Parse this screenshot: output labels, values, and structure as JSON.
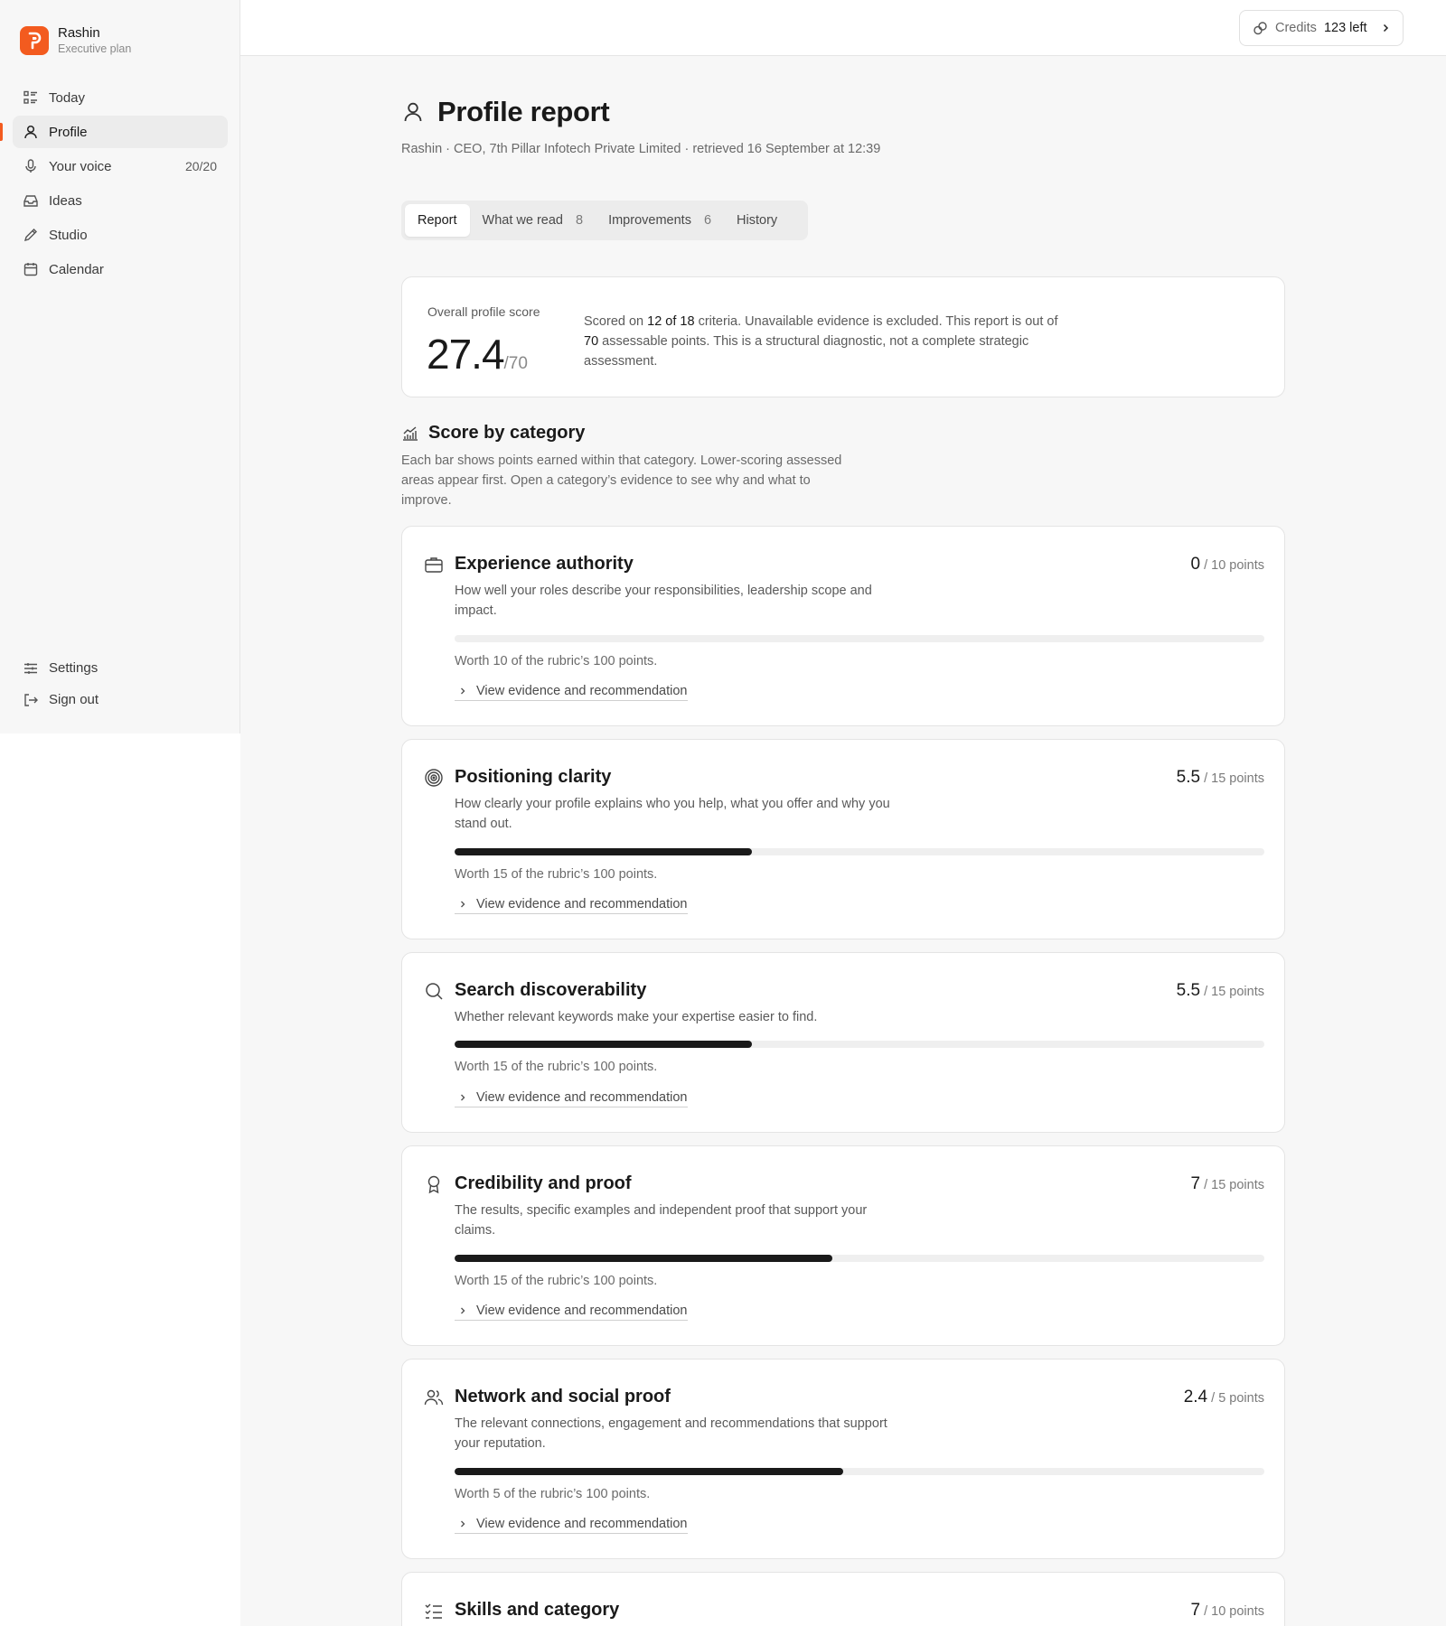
{
  "brand": {
    "name": "Rashin",
    "plan": "Executive plan"
  },
  "nav": {
    "items": [
      {
        "label": "Today",
        "icon": "list-icon"
      },
      {
        "label": "Profile",
        "icon": "user-icon",
        "active": true
      },
      {
        "label": "Your voice",
        "icon": "mic-icon",
        "count": "20/20"
      },
      {
        "label": "Ideas",
        "icon": "inbox-icon"
      },
      {
        "label": "Studio",
        "icon": "pencil-icon"
      },
      {
        "label": "Calendar",
        "icon": "calendar-icon"
      }
    ],
    "bottom": [
      {
        "label": "Settings",
        "icon": "sliders-icon"
      },
      {
        "label": "Sign out",
        "icon": "sign-out-icon"
      }
    ]
  },
  "credits": {
    "label": "Credits",
    "value": "123 left"
  },
  "page": {
    "title": "Profile report",
    "subtitle": "Rashin · CEO, 7th Pillar Infotech Private Limited · retrieved 16 September at 12:39"
  },
  "tabs": [
    {
      "label": "Report",
      "count": ""
    },
    {
      "label": "What we read",
      "count": "8"
    },
    {
      "label": "Improvements",
      "count": "6"
    },
    {
      "label": "History",
      "count": ""
    }
  ],
  "score": {
    "label": "Overall profile score",
    "value": "27.4",
    "max": "/70",
    "desc_1": "Scored on ",
    "desc_criteria": "12 of 18",
    "desc_2": " criteria. Unavailable evidence is excluded. This report is out of ",
    "desc_points": "70",
    "desc_3": " assessable points. This is a structural diagnostic, not a complete strategic assessment."
  },
  "section": {
    "title": "Score by category",
    "desc": "Each bar shows points earned within that category. Lower-scoring assessed areas appear first. Open a category’s evidence to see why and what to improve."
  },
  "link_label": "View evidence and recommendation",
  "categories": [
    {
      "title": "Experience authority",
      "score": "0",
      "max": "/ 10 points",
      "fraction": 0,
      "desc": "How well your roles describe your responsibilities, leadership scope and impact.",
      "worth": "Worth 10 of the rubric’s 100 points.",
      "icon": "briefcase-icon"
    },
    {
      "title": "Positioning clarity",
      "score": "5.5",
      "max": "/ 15 points",
      "fraction": 0.367,
      "desc": "How clearly your profile explains who you help, what you offer and why you stand out.",
      "worth": "Worth 15 of the rubric’s 100 points.",
      "icon": "target-icon"
    },
    {
      "title": "Search discoverability",
      "score": "5.5",
      "max": "/ 15 points",
      "fraction": 0.367,
      "desc": "Whether relevant keywords make your expertise easier to find.",
      "worth": "Worth 15 of the rubric’s 100 points.",
      "icon": "search-icon"
    },
    {
      "title": "Credibility and proof",
      "score": "7",
      "max": "/ 15 points",
      "fraction": 0.467,
      "desc": "The results, specific examples and independent proof that support your claims.",
      "worth": "Worth 15 of the rubric’s 100 points.",
      "icon": "award-icon"
    },
    {
      "title": "Network and social proof",
      "score": "2.4",
      "max": "/ 5 points",
      "fraction": 0.48,
      "desc": "The relevant connections, engagement and recommendations that support your reputation.",
      "worth": "Worth 5 of the rubric’s 100 points.",
      "icon": "users-icon"
    },
    {
      "title": "Skills and category",
      "score": "7",
      "max": "/ 10 points",
      "fraction": 0.7,
      "desc": "",
      "worth": "",
      "icon": "checklist-icon"
    }
  ]
}
